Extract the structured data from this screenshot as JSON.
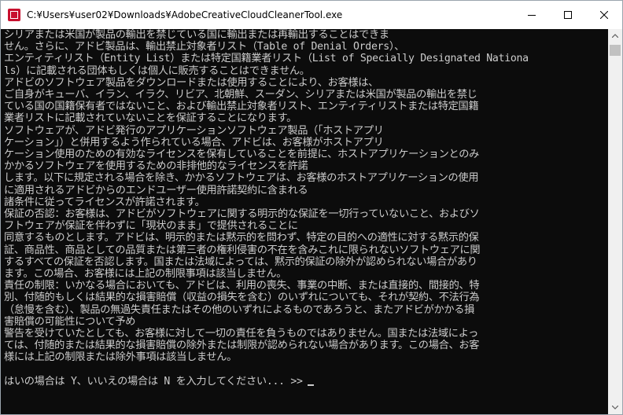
{
  "window": {
    "title": "C:¥Users¥user02¥Downloads¥AdobeCreativeCloudCleanerTool.exe",
    "app_icon": "adobe-exe-icon",
    "controls": [
      "minimize-icon",
      "maximize-icon",
      "close-icon"
    ]
  },
  "console": {
    "lines": [
      "シリアまたは米国が製品の輸出を禁じている国に輸出または再輸出することはできま",
      "せん。さらに、アドビ製品は、輸出禁止対象者リスト（Table of Denial Orders）、",
      "エンティティリスト（Entity List）または特定国籍業者リスト（List of Specially Designated Nationa",
      "ls）に記載される団体もしくは個人に販売することはできません。",
      "アドビのソフトウェア製品をダウンロードまたは使用することにより、お客様は、",
      "ご自身がキューバ、イラン、イラク、リビア、北朝鮮、スーダン、シリアまたは米国が製品の輸出を禁じ",
      "ている国の国籍保有者ではないこと、および輸出禁止対象者リスト、エンティティリストまたは特定国籍",
      "業者リストに記載されていないことを保証することになります。",
      "ソフトウェアが、アドビ発行のアプリケーションソフトウェア製品（「ホストアプリ",
      "ケーション」）と併用するよう作られている場合、アドビは、お客様がホストアプリ",
      "ケーション使用のための有効なライセンスを保有していることを前提に、ホストアプリケーションとのみ",
      "かかるソフトウェアを使用するための非排他的なライセンスを許諾",
      "します。以下に規定される場合を除き、かかるソフトウェアは、お客様のホストアプリケーションの使用",
      "に適用されるアドビからのエンドユーザー使用許諾契約に含まれる",
      "諸条件に従ってライセンスが許諾されます。",
      "保証の否認：お客様は、アドビがソフトウェアに関する明示的な保証を一切行っていないこと、およびソ",
      "フトウェアが保証を伴わずに「現状のまま」で提供されることに",
      "同意するものとします。アドビは、明示的または黙示的を問わず、特定の目的への適性に対する黙示的保",
      "証、商品性、商品としての品質または第三者の権利侵害の不在を含みこれに限られないソフトウェアに関",
      "するすべての保証を否認します。国または法域によっては、黙示的保証の除外が認められない場合があり",
      "ます。この場合、お客様には上記の制限事項は該当しません。",
      "責任の制限：いかなる場合においても、アドビは、利用の喪失、事業の中断、または直接的、間接的、特",
      "別、付随的もしくは結果的な損害賠償（収益の損失を含む）のいずれについても、それが契約、不法行為",
      "（怠慢を含む）、製品の無過失責任またはその他のいずれによるものであろうと、またアドビがかかる損",
      "害賠償の可能性について予め",
      "警告を受けていたとしても、お客様に対して一切の責任を負うものではありません。国または法域によっ",
      "ては、付随的または結果的な損害賠償の除外または制限が認められない場合があります。この場合、お客",
      "様には上記の制限または除外事項は該当しません。"
    ],
    "prompt": "はいの場合は Y、いいえの場合は N を入力してください... >>"
  },
  "scrollbar": {
    "up_icon": "scroll-up-arrow-icon",
    "down_icon": "scroll-down-arrow-icon",
    "position_fraction": 0.0
  }
}
